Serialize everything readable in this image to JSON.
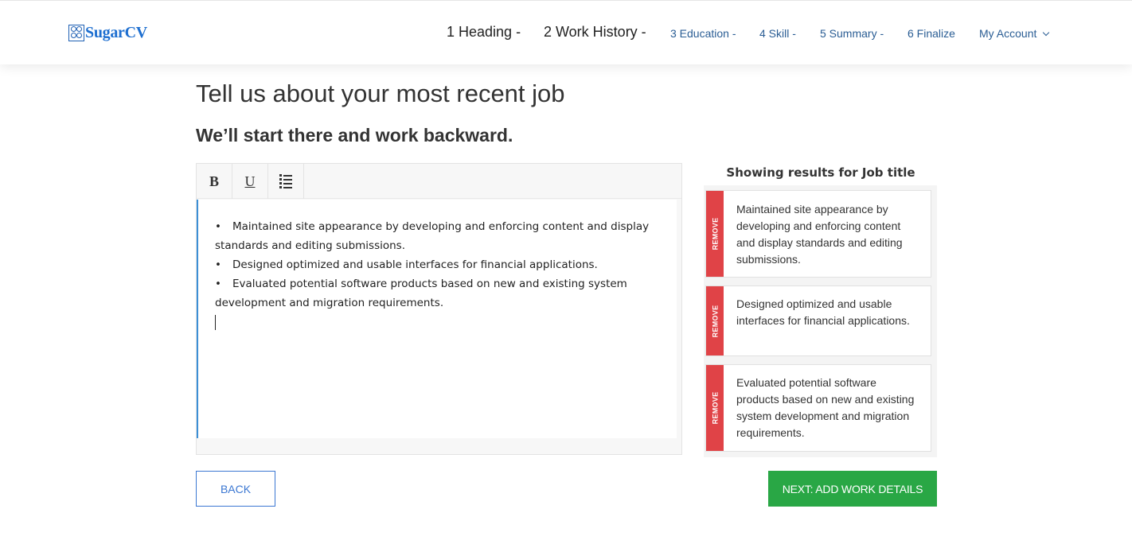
{
  "brand": {
    "name": "SugarCV"
  },
  "nav": {
    "steps": [
      {
        "label": "1 Heading -",
        "state": "done"
      },
      {
        "label": "2 Work History -",
        "state": "current"
      },
      {
        "label": "3 Education -",
        "state": "todo"
      },
      {
        "label": "4 Skill -",
        "state": "todo"
      },
      {
        "label": "5 Summary -",
        "state": "todo"
      },
      {
        "label": "6 Finalize",
        "state": "todo"
      }
    ],
    "account_label": "My Account"
  },
  "page": {
    "title": "Tell us about your most recent job",
    "subtitle": "We’ll start there and work backward."
  },
  "editor": {
    "toolbar": {
      "bold": "B",
      "underline": "U",
      "list_icon": "list-icon"
    },
    "bullet_char": "•",
    "lines": [
      "Maintained site appearance by developing and enforcing content and display standards and editing submissions.",
      "Designed optimized and usable interfaces for financial applications.",
      "Evaluated potential software products based on new and existing system development and migration requirements."
    ]
  },
  "suggestions": {
    "title": "Showing results for Job title",
    "remove_label": "REMOVE",
    "items": [
      "Maintained site appearance by developing and enforcing content and display standards and editing submissions.",
      "Designed optimized and usable interfaces for financial applications.",
      "Evaluated potential software products based on new and existing system development and migration requirements."
    ]
  },
  "actions": {
    "back_label": "BACK",
    "next_label": "NEXT: ADD WORK DETAILS"
  },
  "colors": {
    "brand_blue": "#1e6fd0",
    "nav_link": "#2a5d94",
    "remove_red": "#e04347",
    "next_green": "#29a745",
    "editor_accent": "#3b8fd6"
  }
}
